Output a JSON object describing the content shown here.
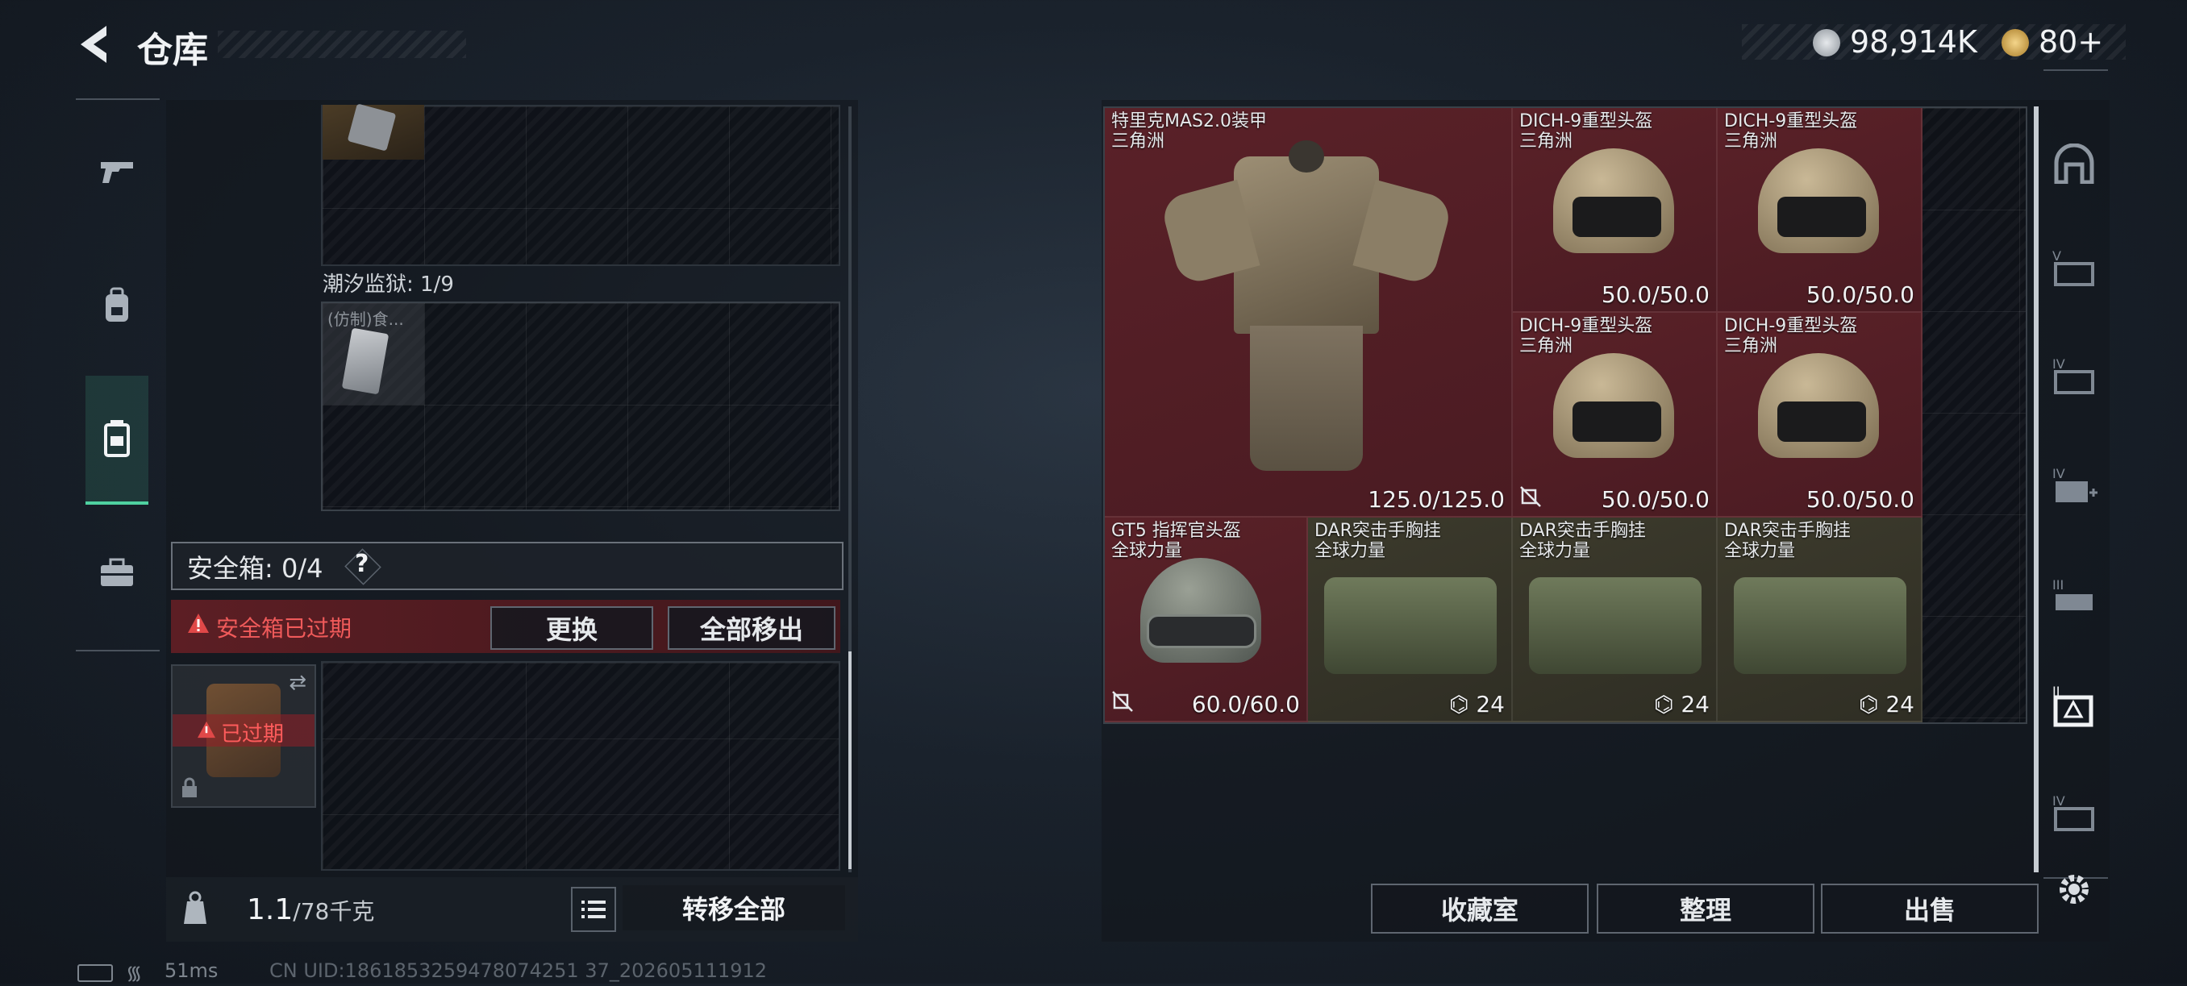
{
  "header": {
    "back_icon": "back-arrow-icon",
    "title": "仓库"
  },
  "currency": {
    "silver": "98,914K",
    "gold": "80+"
  },
  "left_panel": {
    "prison_label": "潮汐监狱: 1/9",
    "prison_item_name": "(仿制)食...",
    "safe_box_label": "安全箱: 0/4",
    "help_label": "?",
    "expired_warning": "安全箱已过期",
    "replace_button": "更换",
    "move_all_out_button": "全部移出",
    "expired_badge": "已过期",
    "weight": "1.1",
    "weight_capacity": "/78千克",
    "transfer_all_button": "转移全部"
  },
  "sidebar": {
    "items": [
      "gun-icon",
      "backpack-icon",
      "safebox-icon",
      "toolbox-icon"
    ]
  },
  "storage": {
    "items": [
      {
        "name": "特里克MAS2.0装甲",
        "sub": "三角洲",
        "value": "125.0/125.0"
      },
      {
        "name": "DICH-9重型头盔",
        "sub": "三角洲",
        "value": "50.0/50.0"
      },
      {
        "name": "DICH-9重型头盔",
        "sub": "三角洲",
        "value": "50.0/50.0"
      },
      {
        "name": "DICH-9重型头盔",
        "sub": "三角洲",
        "value": "50.0/50.0"
      },
      {
        "name": "DICH-9重型头盔",
        "sub": "三角洲",
        "value": "50.0/50.0"
      },
      {
        "name": "GT5 指挥官头盔",
        "sub": "全球力量",
        "value": "60.0/60.0"
      },
      {
        "name": "DAR突击手胸挂",
        "sub": "全球力量",
        "value": "24"
      },
      {
        "name": "DAR突击手胸挂",
        "sub": "全球力量",
        "value": "24"
      },
      {
        "name": "DAR突击手胸挂",
        "sub": "全球力量",
        "value": "24"
      }
    ],
    "collection_button": "收藏室",
    "sort_button": "整理",
    "sell_button": "出售"
  },
  "right_tabs": [
    "home-icon",
    "stash-v-icon",
    "stash-iv-icon",
    "stash-iv-plus-icon",
    "stash-iii-icon",
    "stash-ii-active-icon",
    "stash-iv-locked-icon",
    "settings-icon"
  ],
  "status_bar": {
    "ping": "51ms",
    "uid": "CN UID:1861853259478074251 37_202605111912"
  },
  "colors": {
    "red_cell": "#5a2128",
    "olive_cell": "#3c3a2c",
    "accent_green": "#4fd1a0",
    "warning_red": "#e04848"
  }
}
